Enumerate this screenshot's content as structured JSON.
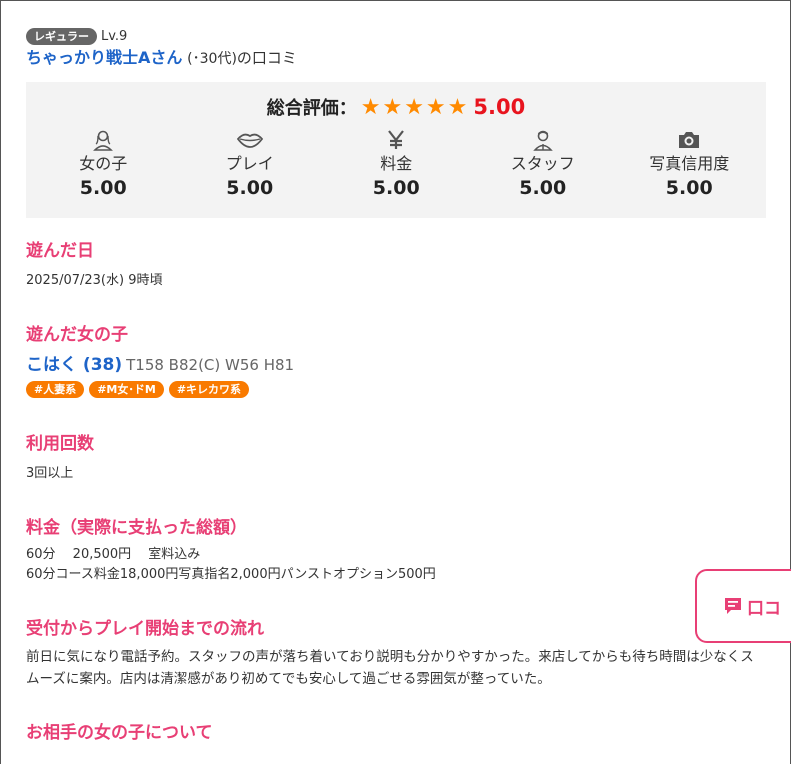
{
  "reviewer": {
    "badge": "レギュラー",
    "level": "Lv.9",
    "name": "ちゃっかり戦士Aさん",
    "age": "(･30代)",
    "suffix": "の口コミ"
  },
  "overall": {
    "label": "総合評価：",
    "stars": "★★★★★",
    "score": "5.00",
    "colors": {
      "star": "#ff8a00",
      "score": "#e8141e"
    }
  },
  "categories": [
    {
      "icon": "woman-icon",
      "label": "女の子",
      "value": "5.00"
    },
    {
      "icon": "lips-icon",
      "label": "プレイ",
      "value": "5.00"
    },
    {
      "icon": "yen-icon",
      "label": "料金",
      "value": "5.00"
    },
    {
      "icon": "staff-icon",
      "label": "スタッフ",
      "value": "5.00"
    },
    {
      "icon": "camera-icon",
      "label": "写真信用度",
      "value": "5.00"
    }
  ],
  "sections": {
    "visit_date": {
      "title": "遊んだ日",
      "text": "2025/07/23(水) 9時頃"
    },
    "girl": {
      "title": "遊んだ女の子",
      "name": "こはく",
      "age": "(38)",
      "stats": "T158 B82(C) W56 H81",
      "tags": [
        "#人妻系",
        "#M女･ドM",
        "#キレカワ系"
      ]
    },
    "visits": {
      "title": "利用回数",
      "text": "3回以上"
    },
    "price": {
      "title": "料金（実際に支払った総額）",
      "line1": "60分　 20,500円　 室料込み",
      "line2": "60分コース料金18,000円写真指名2,000円パンストオプション500円"
    },
    "flow": {
      "title": "受付からプレイ開始までの流れ",
      "text": "前日に気になり電話予約。スタッフの声が落ち着いており説明も分かりやすかった。来店してからも待ち時間は少なくスムーズに案内。店内は清潔感があり初めてでも安心して過ごせる雰囲気が整っていた。"
    },
    "about_girl": {
      "title": "お相手の女の子について"
    }
  },
  "float_button": {
    "icon": "comment-icon",
    "label": "口コ"
  },
  "colors": {
    "accent": "#e83f75",
    "link": "#1e64c8",
    "tag": "#f97a00"
  }
}
